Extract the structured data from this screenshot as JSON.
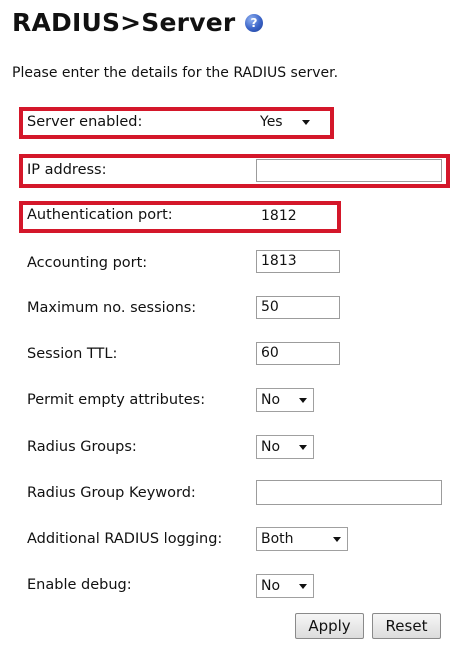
{
  "header": {
    "title": "RADIUS>Server",
    "help_icon": "help-question-icon",
    "help_glyph": "?"
  },
  "intro_text": "Please enter the details for the RADIUS server.",
  "fields": {
    "server_enabled": {
      "label": "Server enabled:",
      "value": "Yes"
    },
    "ip_address": {
      "label": "IP address:",
      "value": ""
    },
    "auth_port": {
      "label": "Authentication port:",
      "value": "1812"
    },
    "acct_port": {
      "label": "Accounting port:",
      "value": "1813"
    },
    "max_sessions": {
      "label": "Maximum no. sessions:",
      "value": "50"
    },
    "session_ttl": {
      "label": "Session TTL:",
      "value": "60"
    },
    "permit_empty": {
      "label": "Permit empty attributes:",
      "value": "No"
    },
    "radius_groups": {
      "label": "Radius Groups:",
      "value": "No"
    },
    "group_keyword": {
      "label": "Radius Group Keyword:",
      "value": ""
    },
    "additional_logging": {
      "label": "Additional RADIUS logging:",
      "value": "Both"
    },
    "enable_debug": {
      "label": "Enable debug:",
      "value": "No"
    }
  },
  "buttons": {
    "apply": "Apply",
    "reset": "Reset"
  },
  "colors": {
    "highlight": "#d4172a",
    "help_icon": "#3a63c7"
  }
}
